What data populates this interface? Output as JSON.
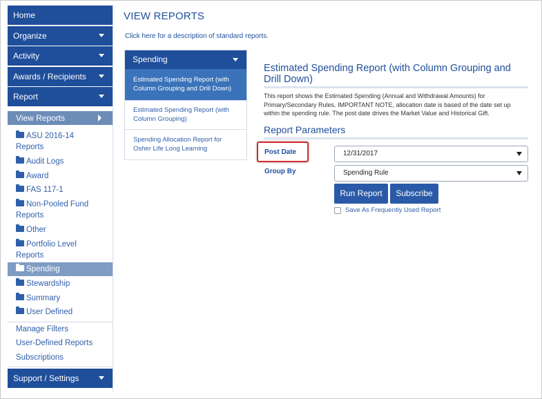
{
  "sidebar": {
    "home": "Home",
    "organize": "Organize",
    "activity": "Activity",
    "awards": "Awards / Recipients",
    "report": "Report",
    "view_reports": "View Reports",
    "folders": {
      "asu_l1": "ASU 2016-14",
      "asu_l2": "Reports",
      "audit": "Audit Logs",
      "award": "Award",
      "fas": "FAS 117-1",
      "npf_l1": "Non-Pooled Fund",
      "npf_l2": "Reports",
      "other": "Other",
      "portfolio_l1": "Portfolio Level",
      "portfolio_l2": "Reports",
      "spending": "Spending",
      "stewardship": "Stewardship",
      "summary": "Summary",
      "user_defined": "User Defined"
    },
    "links": {
      "manage_filters": "Manage Filters",
      "user_defined_reports": "User-Defined Reports",
      "subscriptions": "Subscriptions"
    },
    "support": "Support / Settings"
  },
  "main": {
    "title": "VIEW REPORTS",
    "intro_prefix": "Click ",
    "intro_link": "here",
    "intro_suffix": " for a description of standard reports."
  },
  "category_panel": {
    "header": "Spending",
    "items": [
      {
        "line1": "Estimated Spending Report (with",
        "line2": "Column Grouping and Drill Down)"
      },
      {
        "line1": "Estimated Spending Report (with",
        "line2": "Column Grouping)"
      },
      {
        "line1": "Spending Allocation Report for",
        "line2": "Osher Life Long Learning"
      }
    ]
  },
  "report": {
    "title_l1": "Estimated Spending Report (with Column Grouping and",
    "title_l2": "Drill Down)",
    "desc_l1": "This report shows the Estimated Spending (Annual and Withdrawal Amounts) for",
    "desc_l2": "Primary/Secondary Rules. IMPORTANT NOTE, allocation date is based of the date set up",
    "desc_l3": "within the spending rule. The post date drives the Market Value and Historical Gift.",
    "params_title": "Report Parameters",
    "post_date_label": "Post Date",
    "post_date_value": "12/31/2017",
    "group_by_label": "Group By",
    "group_by_value": "Spending Rule",
    "run_button": "Run Report",
    "subscribe_button": "Subscribe",
    "save_label": "Save As Frequently Used Report"
  },
  "colors": {
    "nav_blue": "#1f4e9a",
    "active_item": "#3a73b9",
    "highlight": "#d52a2a"
  }
}
